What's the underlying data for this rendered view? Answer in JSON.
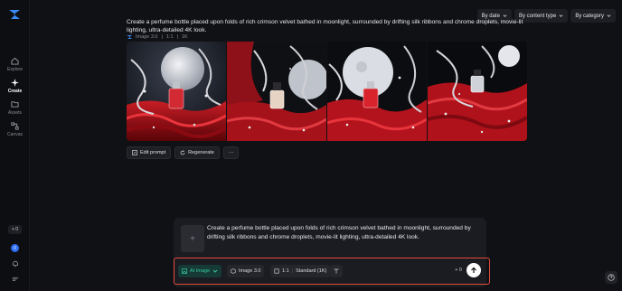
{
  "sidebar": {
    "items": [
      {
        "label": "Explore",
        "icon": "compass-icon"
      },
      {
        "label": "Create",
        "icon": "sparkle-icon"
      },
      {
        "label": "Assets",
        "icon": "folder-icon"
      },
      {
        "label": "Canvas",
        "icon": "canvas-icon"
      }
    ],
    "credits": "+ 0",
    "avatar_initial": "0"
  },
  "filters": [
    {
      "label": "By date"
    },
    {
      "label": "By content type"
    },
    {
      "label": "By category"
    }
  ],
  "generation": {
    "prompt": "Create a perfume bottle placed upon folds of rich crimson velvet bathed in moonlight, surrounded by drifting silk ribbons and chrome droplets, movie-lit lighting, ultra-detailed 4K look.",
    "model": "Image 3.0",
    "ratio": "1:1",
    "resolution": "1K",
    "images": [
      {
        "alt": "perfume-image-1"
      },
      {
        "alt": "perfume-image-2"
      },
      {
        "alt": "perfume-image-3"
      },
      {
        "alt": "perfume-image-4"
      }
    ]
  },
  "actions": {
    "edit_prompt": "Edit prompt",
    "regenerate": "Regenerate",
    "more": "···"
  },
  "composer": {
    "prompt": "Create a perfume bottle placed upon folds of rich crimson velvet bathed in moonlight, surrounded by drifting silk ribbons and chrome droplets, movie-lit lighting, ultra-detailed 4K look.",
    "add_symbol": "+",
    "tool_ai": "AI Image",
    "tool_model": "Image 3.0",
    "tool_ratio": "1:1",
    "tool_quality": "Standard (1K)",
    "credits_cost": "+ 0"
  },
  "colors": {
    "accent_green": "#38c9a4",
    "highlight_red": "#e24b3b",
    "background": "#101114",
    "velvet_red": "#b3131c"
  }
}
